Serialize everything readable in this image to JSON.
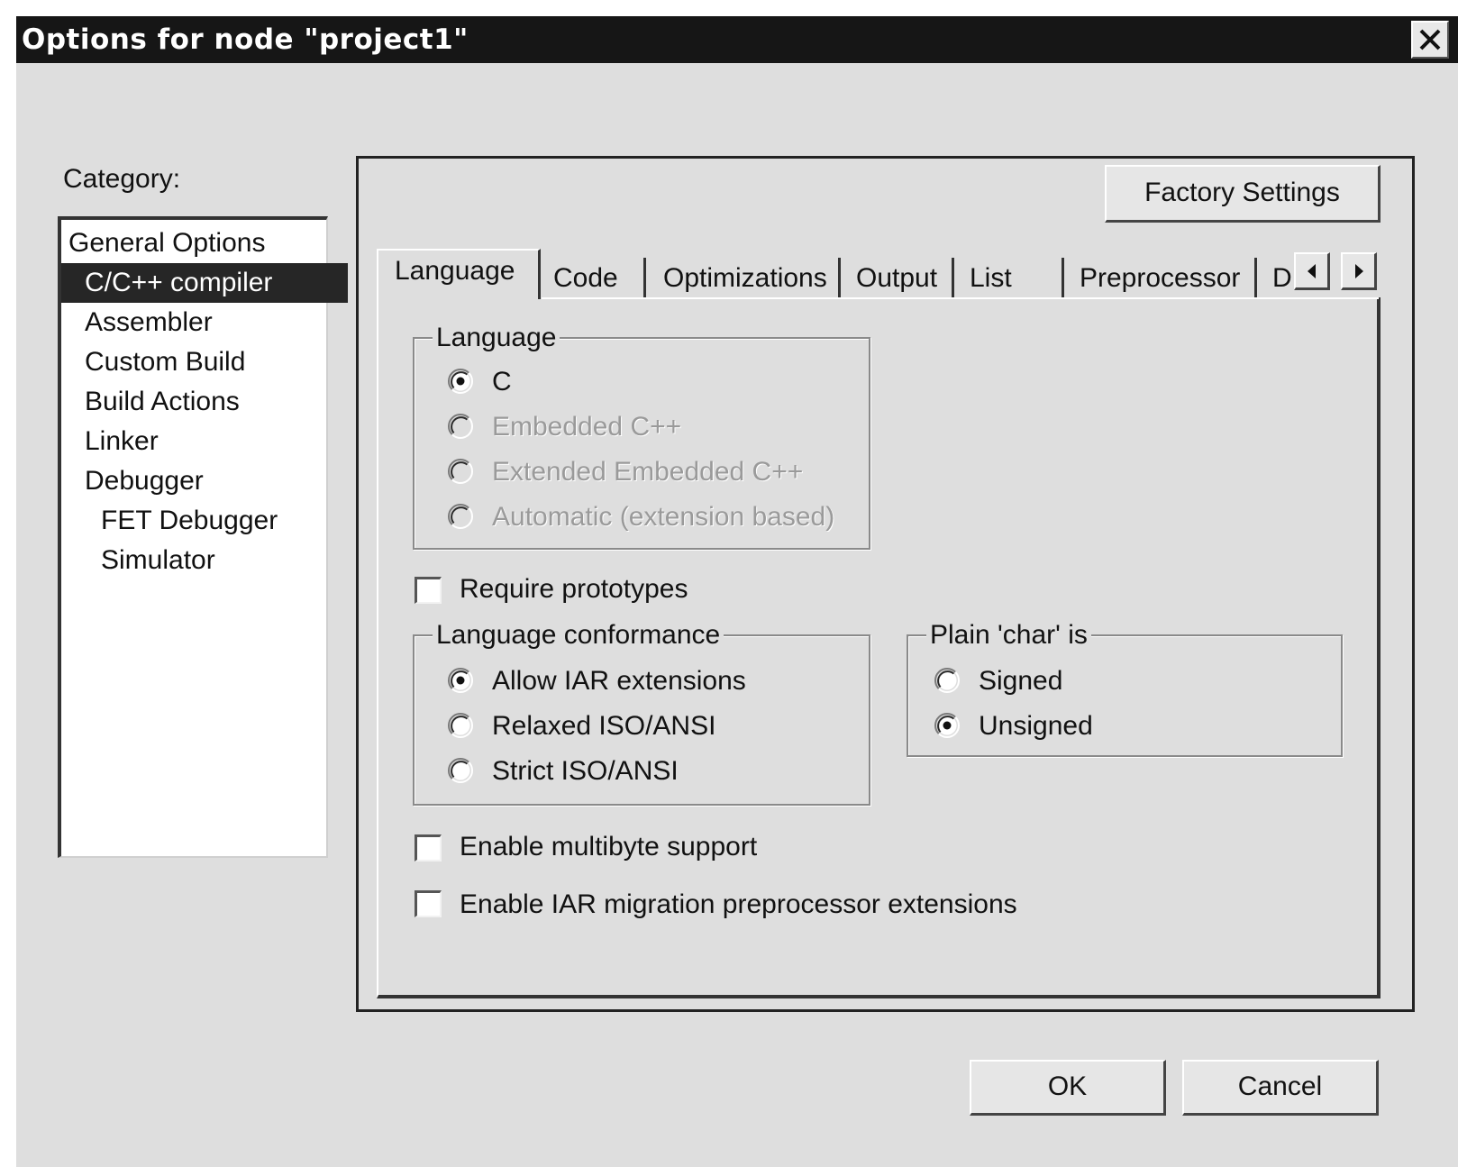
{
  "window": {
    "title": "Options for node \"project1\""
  },
  "category": {
    "label": "Category:",
    "items": [
      {
        "label": "General Options",
        "selected": false
      },
      {
        "label": "C/C++ compiler",
        "selected": true
      },
      {
        "label": "Assembler",
        "selected": false
      },
      {
        "label": "Custom Build",
        "selected": false
      },
      {
        "label": "Build Actions",
        "selected": false
      },
      {
        "label": "Linker",
        "selected": false
      },
      {
        "label": "Debugger",
        "selected": false
      },
      {
        "label": "FET Debugger",
        "selected": false
      },
      {
        "label": "Simulator",
        "selected": false
      }
    ]
  },
  "factory_settings_label": "Factory Settings",
  "tabs": [
    {
      "label": "Language",
      "active": true
    },
    {
      "label": "Code"
    },
    {
      "label": "Optimizations"
    },
    {
      "label": "Output"
    },
    {
      "label": "List"
    },
    {
      "label": "Preprocessor"
    },
    {
      "label": "D"
    }
  ],
  "language_group": {
    "title": "Language",
    "options": [
      {
        "label": "C",
        "checked": true,
        "enabled": true
      },
      {
        "label": "Embedded C++",
        "checked": false,
        "enabled": false
      },
      {
        "label": "Extended Embedded C++",
        "checked": false,
        "enabled": false
      },
      {
        "label": "Automatic (extension based)",
        "checked": false,
        "enabled": false
      }
    ]
  },
  "require_prototypes": {
    "label": "Require prototypes",
    "checked": false
  },
  "conformance_group": {
    "title": "Language conformance",
    "options": [
      {
        "label": "Allow IAR extensions",
        "checked": true
      },
      {
        "label": "Relaxed ISO/ANSI",
        "checked": false
      },
      {
        "label": "Strict ISO/ANSI",
        "checked": false
      }
    ]
  },
  "char_group": {
    "title": "Plain 'char' is",
    "options": [
      {
        "label": "Signed",
        "checked": false
      },
      {
        "label": "Unsigned",
        "checked": true
      }
    ]
  },
  "multibyte": {
    "label": "Enable multibyte support",
    "checked": false
  },
  "migration": {
    "label": "Enable IAR migration preprocessor extensions",
    "checked": false
  },
  "buttons": {
    "ok": "OK",
    "cancel": "Cancel"
  },
  "colors": {
    "title_bar": "#161616",
    "dialog_bg": "#dedede",
    "selection": "#262626"
  }
}
